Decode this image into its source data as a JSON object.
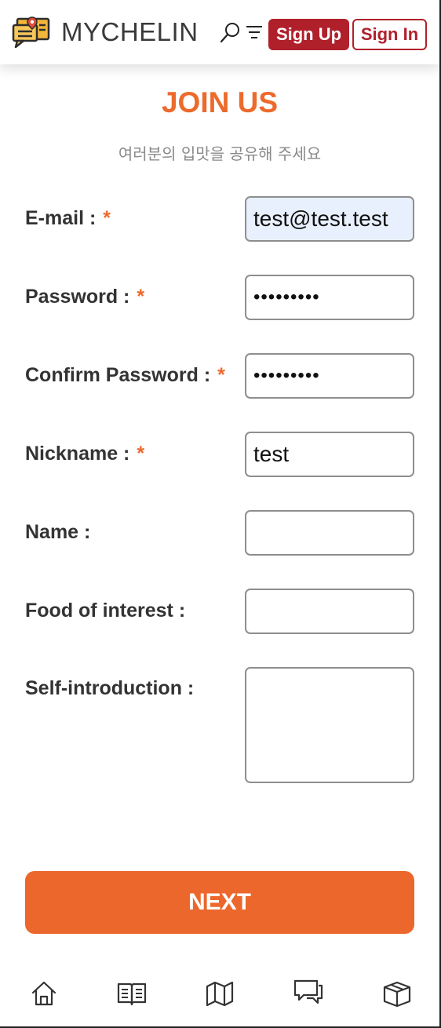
{
  "header": {
    "brand": "MYCHELIN",
    "signup_label": "Sign Up",
    "signin_label": "Sign In"
  },
  "page": {
    "title": "JOIN US",
    "subtitle": "여러분의 입맛을 공유해 주세요"
  },
  "form": {
    "required_marker": "*",
    "fields": [
      {
        "label": "E-mail :",
        "required": true,
        "value": "test@test.test"
      },
      {
        "label": "Password :",
        "required": true,
        "value": "•••••••••"
      },
      {
        "label": "Confirm Password :",
        "required": true,
        "value": "•••••••••"
      },
      {
        "label": "Nickname :",
        "required": true,
        "value": "test"
      },
      {
        "label": "Name :",
        "required": false,
        "value": ""
      },
      {
        "label": "Food of interest :",
        "required": false,
        "value": ""
      },
      {
        "label": "Self-introduction :",
        "required": false,
        "value": ""
      }
    ],
    "next_label": "NEXT"
  },
  "bottom_nav": {
    "items": [
      "home-icon",
      "book-icon",
      "map-icon",
      "chat-icon",
      "box-icon"
    ]
  },
  "colors": {
    "accent_orange": "#ec6a2c",
    "brand_red": "#b0202b",
    "autofill_bg": "#e8f0fe"
  }
}
